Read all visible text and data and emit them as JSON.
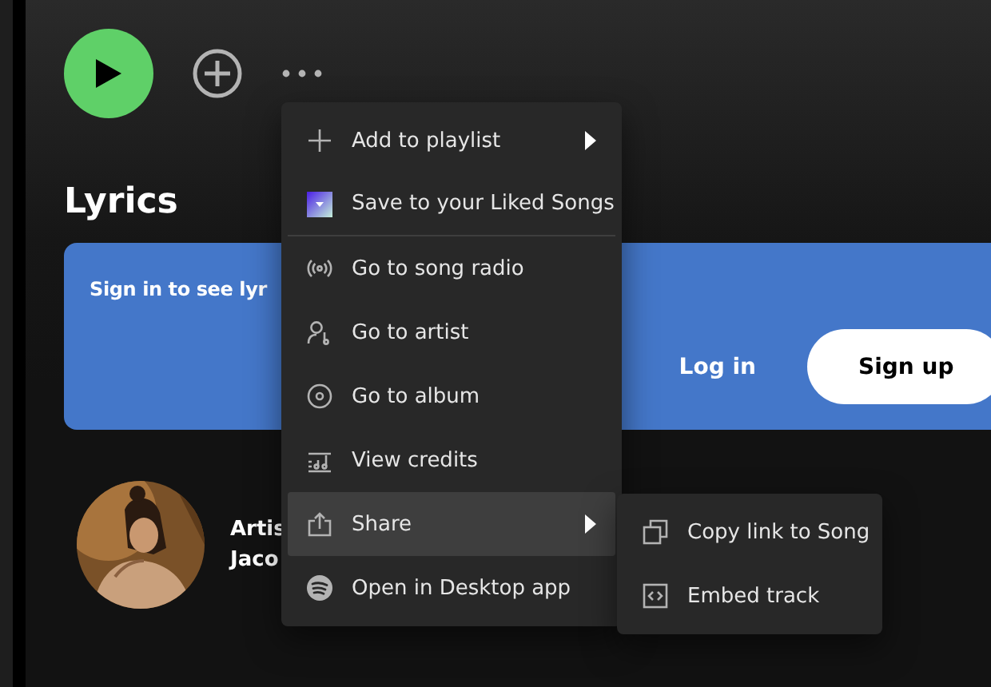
{
  "actions": {
    "play": true
  },
  "lyrics": {
    "heading": "Lyrics",
    "prompt": "Sign in to see lyr",
    "login": "Log in",
    "signup": "Sign up"
  },
  "artist": {
    "label": "Artis",
    "name": "Jaco"
  },
  "menu": {
    "items": [
      {
        "label": "Add to playlist",
        "submenu": true,
        "highlighted": false,
        "divider_after": false
      },
      {
        "label": "Save to your Liked Songs",
        "submenu": false,
        "highlighted": false,
        "divider_after": true
      },
      {
        "label": "Go to song radio",
        "submenu": false,
        "highlighted": false,
        "divider_after": false
      },
      {
        "label": "Go to artist",
        "submenu": false,
        "highlighted": false,
        "divider_after": false
      },
      {
        "label": "Go to album",
        "submenu": false,
        "highlighted": false,
        "divider_after": false
      },
      {
        "label": "View credits",
        "submenu": false,
        "highlighted": false,
        "divider_after": false
      },
      {
        "label": "Share",
        "submenu": true,
        "highlighted": true,
        "divider_after": false
      },
      {
        "label": "Open in Desktop app",
        "submenu": false,
        "highlighted": false,
        "divider_after": false
      }
    ]
  },
  "submenu": {
    "items": [
      {
        "label": "Copy link to Song"
      },
      {
        "label": "Embed track"
      }
    ]
  }
}
